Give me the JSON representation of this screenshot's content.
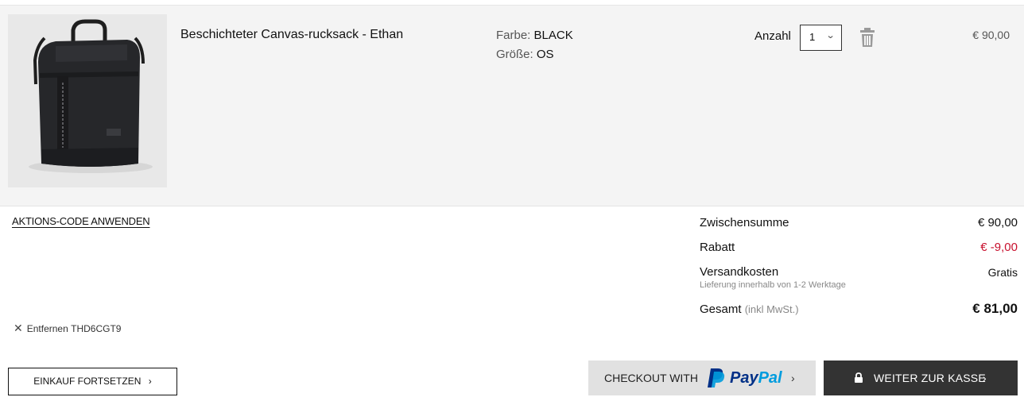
{
  "item": {
    "name": "Beschichteter Canvas-rucksack - Ethan",
    "color_label": "Farbe:",
    "color_value": "BLACK",
    "size_label": "Größe:",
    "size_value": "OS",
    "quantity_label": "Anzahl",
    "quantity_value": "1",
    "price": "€ 90,00"
  },
  "promo": {
    "apply_link": "AKTIONS-CODE ANWENDEN",
    "remove_label": "Entfernen",
    "code": "THD6CGT9"
  },
  "summary": {
    "subtotal_label": "Zwischensumme",
    "subtotal_value": "€ 90,00",
    "discount_label": "Rabatt",
    "discount_value": "€ -9,00",
    "shipping_label": "Versandkosten",
    "shipping_value": "Gratis",
    "shipping_note": "Lieferung innerhalb von 1-2 Werktage",
    "total_label": "Gesamt",
    "total_note": "(inkl MwSt.)",
    "total_value": "€ 81,00"
  },
  "buttons": {
    "continue_shopping": "EINKAUF FORTSETZEN",
    "paypal_prefix": "CHECKOUT WITH",
    "paypal_brand_1": "Pay",
    "paypal_brand_2": "Pal",
    "checkout": "WEITER ZUR KASSE",
    "chevron": "›"
  },
  "icons": {
    "trash": "trash-icon",
    "close": "close-icon",
    "lock": "lock-icon",
    "chevron_down": "chevron-down-icon",
    "paypal": "paypal-logo"
  },
  "colors": {
    "row_background": "#f4f4f4",
    "discount": "#c8102e",
    "checkout_button": "#333333",
    "paypal_button": "#e1e1e1",
    "paypal_dark": "#003087",
    "paypal_light": "#009cde"
  }
}
